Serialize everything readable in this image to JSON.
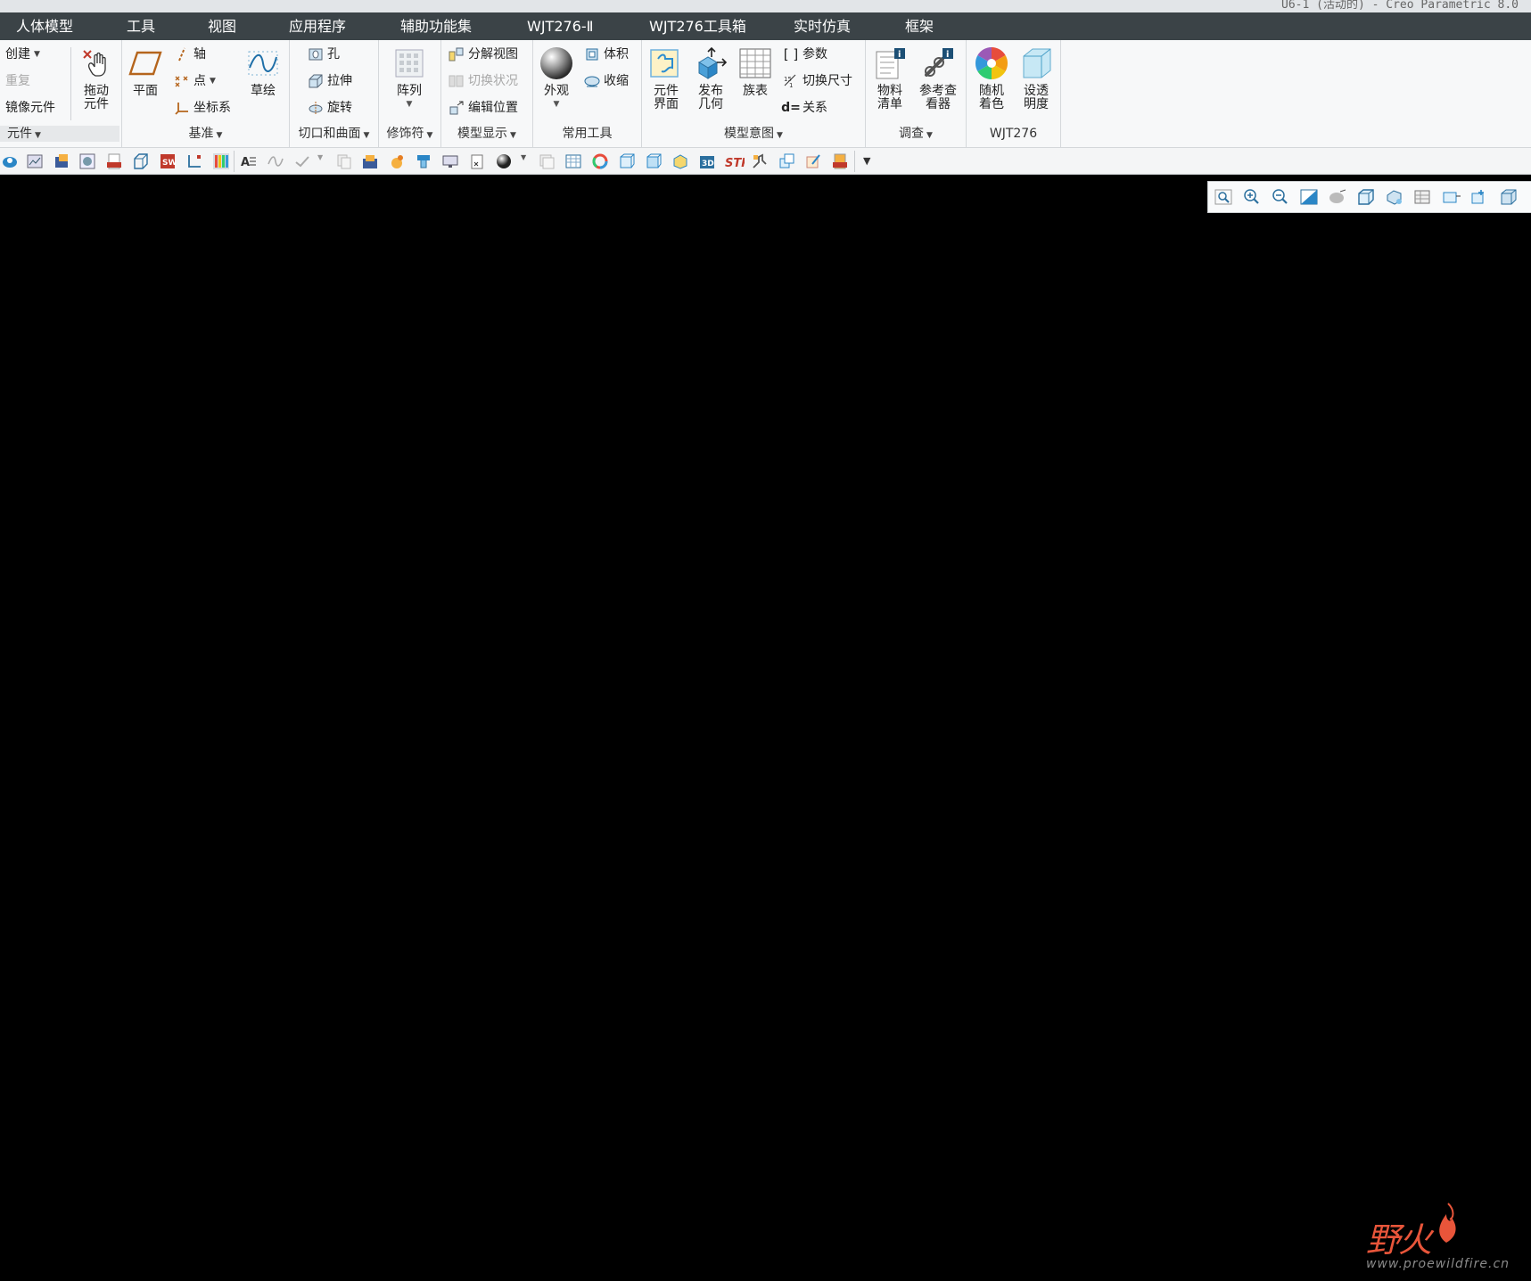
{
  "window": {
    "title": "U6-1 (活动的) - Creo Parametric 8.0"
  },
  "menu_tabs": [
    "人体模型",
    "工具",
    "视图",
    "应用程序",
    "辅助功能集",
    "WJT276-Ⅱ",
    "WJT276工具箱",
    "实时仿真",
    "框架"
  ],
  "ribbon": {
    "component": {
      "create": "创建",
      "redo": "重复",
      "mirror": "镜像元件",
      "drag_l1": "拖动",
      "drag_l2": "元件",
      "label": "元件"
    },
    "datum": {
      "plane": "平面",
      "axis": "轴",
      "point": "点",
      "csys": "坐标系",
      "sketch": "草绘",
      "label": "基准"
    },
    "cut_surface": {
      "hole": "孔",
      "extrude": "拉伸",
      "revolve": "旋转",
      "label": "切口和曲面"
    },
    "modifiers": {
      "pattern": "阵列",
      "label": "修饰符"
    },
    "model_display": {
      "explode": "分解视图",
      "toggle_status": "切换状况",
      "edit_position": "编辑位置",
      "label": "模型显示"
    },
    "common_tools": {
      "appearance": "外观",
      "volume": "体积",
      "shrink": "收缩",
      "label": "常用工具"
    },
    "model_intent": {
      "comp_if_l1": "元件",
      "comp_if_l2": "界面",
      "pub_l1": "发布",
      "pub_l2": "几何",
      "family": "族表",
      "params": "参数",
      "switch_dims": "切换尺寸",
      "relations": "关系",
      "label": "模型意图"
    },
    "investigate": {
      "bom_l1": "物料",
      "bom_l2": "清单",
      "ref_l1": "参考查",
      "ref_l2": "看器",
      "label": "调查"
    },
    "wjt276": {
      "color_l1": "随机",
      "color_l2": "着色",
      "trans_l1": "设透",
      "trans_l2": "明度",
      "label": "WJT276"
    }
  },
  "quick_toolbar": {
    "icons": [
      "cad-icon",
      "image-icon",
      "export-icon",
      "render-icon",
      "pdf-icon",
      "box-icon",
      "solidworks-icon",
      "dimension-icon",
      "color-bars-icon",
      "text-icon",
      "curve-icon",
      "check-icon",
      "copy-icon",
      "folder-icon",
      "paint-icon",
      "mold-icon",
      "display-icon",
      "clipboard-icon",
      "sphere-icon",
      "layer-icon",
      "table-icon",
      "wheel-icon",
      "cube-icon",
      "cube2-icon",
      "package-icon",
      "3d-icon",
      "stp-icon",
      "tools-icon",
      "copy2-icon",
      "edit-icon",
      "pdf2-icon"
    ]
  },
  "view_toolbar": {
    "icons": [
      "refit-icon",
      "zoom-in-icon",
      "zoom-out-icon",
      "repaint-icon",
      "display-style-icon",
      "saved-views-icon",
      "view-manager-icon",
      "perspective-icon",
      "annotation-icon",
      "datum-display-icon",
      "spin-center-icon"
    ]
  },
  "watermark": {
    "brand": "野火",
    "url": "www.proewildfire.cn"
  },
  "colors": {
    "menubar": "#3b4347",
    "ribbon": "#f7f8f9",
    "canvas": "#000000",
    "brand": "#e8553a"
  }
}
